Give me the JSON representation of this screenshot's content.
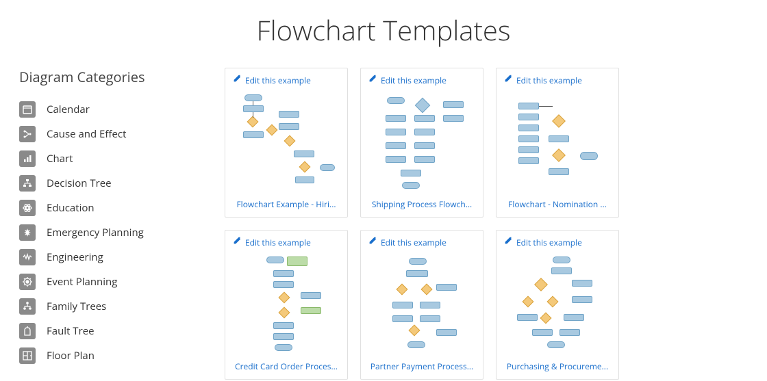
{
  "page_title": "Flowchart Templates",
  "sidebar": {
    "title": "Diagram Categories",
    "items": [
      {
        "label": "Calendar",
        "icon": "calendar-icon"
      },
      {
        "label": "Cause and Effect",
        "icon": "cause-effect-icon"
      },
      {
        "label": "Chart",
        "icon": "chart-icon"
      },
      {
        "label": "Decision Tree",
        "icon": "decision-tree-icon"
      },
      {
        "label": "Education",
        "icon": "education-icon"
      },
      {
        "label": "Emergency Planning",
        "icon": "emergency-icon"
      },
      {
        "label": "Engineering",
        "icon": "engineering-icon"
      },
      {
        "label": "Event Planning",
        "icon": "event-icon"
      },
      {
        "label": "Family Trees",
        "icon": "family-tree-icon"
      },
      {
        "label": "Fault Tree",
        "icon": "fault-tree-icon"
      },
      {
        "label": "Floor Plan",
        "icon": "floor-plan-icon"
      }
    ]
  },
  "edit_label": "Edit this example",
  "templates": [
    {
      "title": "Flowchart Example - Hiri..."
    },
    {
      "title": "Shipping Process Flowch..."
    },
    {
      "title": "Flowchart - Nomination ..."
    },
    {
      "title": "Credit Card Order Proces..."
    },
    {
      "title": "Partner Payment Process..."
    },
    {
      "title": "Purchasing & Procureme..."
    }
  ]
}
